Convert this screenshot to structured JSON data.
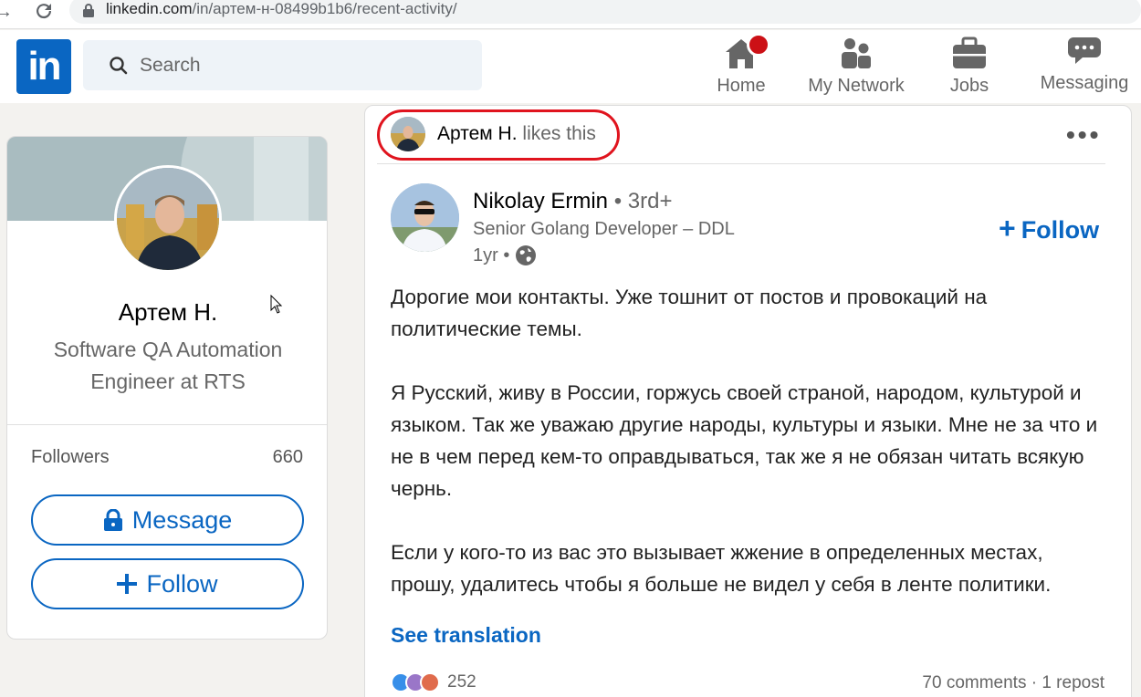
{
  "browser": {
    "url_domain": "linkedin.com",
    "url_path": "/in/артем-н-08499b1b6/recent-activity/"
  },
  "header": {
    "logo_text": "in",
    "search_placeholder": "Search",
    "nav": [
      {
        "label": "Home",
        "icon": "home-icon"
      },
      {
        "label": "My Network",
        "icon": "network-icon"
      },
      {
        "label": "Jobs",
        "icon": "briefcase-icon"
      },
      {
        "label": "Messaging",
        "icon": "messaging-icon"
      }
    ]
  },
  "profile": {
    "name": "Артем Н.",
    "headline": "Software QA Automation Engineer at RTS",
    "followers_label": "Followers",
    "followers_count": "660",
    "message_label": "Message",
    "follow_label": "Follow"
  },
  "post": {
    "liker_name": "Артем Н.",
    "liker_action": "likes this",
    "more_label": "•••",
    "author_name": "Nikolay Ermin",
    "author_degree": "• 3rd+",
    "author_title": "Senior Golang Developer – DDL",
    "time": "1yr •",
    "follow_label": "Follow",
    "follow_plus": "+",
    "paragraphs": [
      "Дорогие мои контакты. Уже тошнит от постов и провокаций на политические темы.",
      "Я Русский, живу в России, горжусь своей страной, народом, культурой и языком. Так же уважаю другие народы, культуры и языки. Мне не за что и не в чем перед кем-то оправдываться, так же я не обязан читать всякую чернь.",
      "Если у кого-то из вас это вызывает жжение в определенных местах, прошу, удалитесь чтобы я больше не видел у себя в ленте политики."
    ],
    "see_translation": "See translation",
    "reaction_count": "252",
    "stats": "70 comments · 1 repost"
  },
  "colors": {
    "brand": "#0a66c2",
    "highlight": "#e0141e",
    "notification": "#cc1016"
  }
}
